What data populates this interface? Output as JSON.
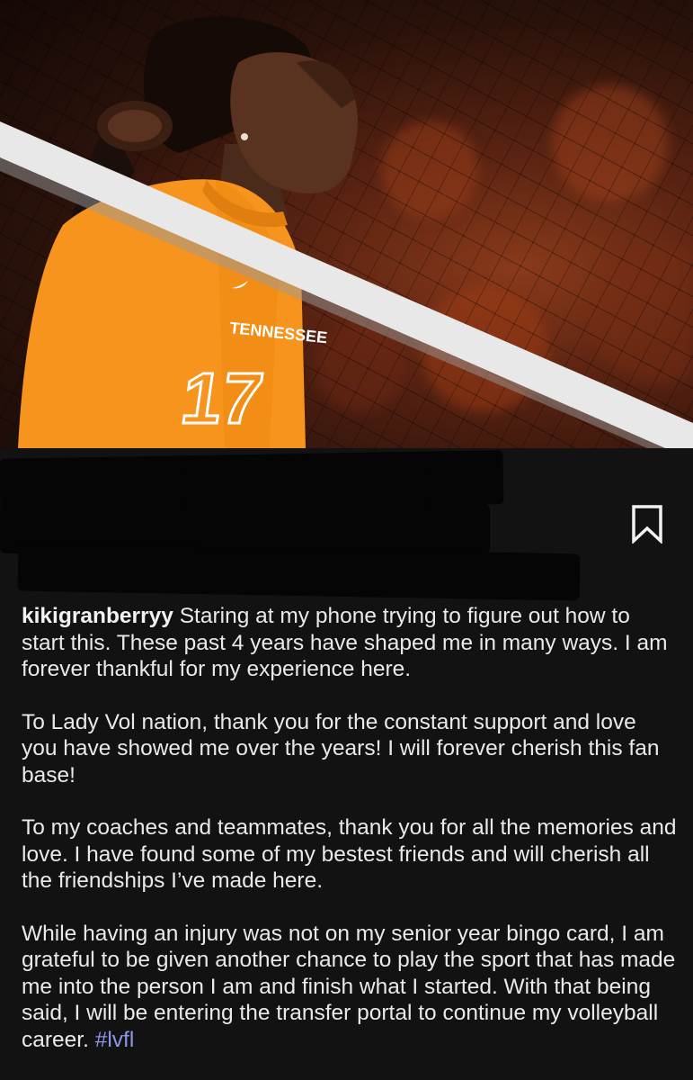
{
  "photo": {
    "jersey_text": "TENNESSEE",
    "jersey_number": "17",
    "colors": {
      "jersey": "#f7941d",
      "background": "#5a2312",
      "net_tape": "#e8e8e8"
    }
  },
  "post": {
    "username": "kikigranberryy",
    "paragraphs": [
      "Staring at my phone trying to figure out how to start this. These past 4 years have shaped me in many ways. I am forever thankful for my experience here.",
      "To Lady Vol nation, thank you for the constant support and love you have showed me over the years! I will forever cherish this fan base!",
      "To my coaches and teammates, thank you for all the memories and love. I have found some of my bestest friends and will cherish all the friendships I’ve made here.",
      "While having an injury was not on my senior year bingo card, I am grateful to be given another chance to play the sport that has made me into the person I am and finish what I started. With that being said, I will be entering the transfer portal to continue my volleyball career."
    ],
    "hashtag": "#lvfl"
  },
  "icons": {
    "bookmark": "bookmark-icon"
  }
}
